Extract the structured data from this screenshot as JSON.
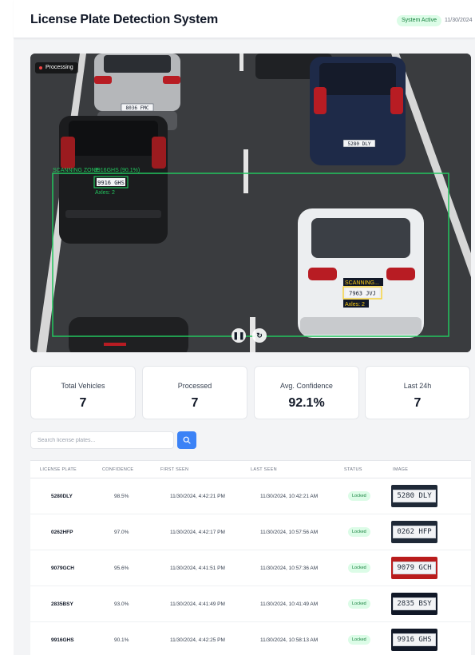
{
  "header": {
    "title": "License Plate Detection System",
    "status": "System Active",
    "date": "11/30/2024"
  },
  "feed": {
    "processing_label": "Processing",
    "zone_label": "SCANNING ZONE",
    "detection_1": {
      "label": "9916GHS (90.1%)",
      "plate": "9916 GHS",
      "axles": "Axles: 2"
    },
    "detection_2": {
      "label": "SCANNING...",
      "plate": "7963 JVJ",
      "axles": "Axles: 2"
    },
    "car_plates": [
      "8036 FMC",
      "5280 DLY"
    ],
    "pause_icon": "pause-icon",
    "refresh_icon": "refresh-icon"
  },
  "stats": [
    {
      "label": "Total Vehicles",
      "value": "7"
    },
    {
      "label": "Processed",
      "value": "7"
    },
    {
      "label": "Avg. Confidence",
      "value": "92.1%"
    },
    {
      "label": "Last 24h",
      "value": "7"
    }
  ],
  "search": {
    "placeholder": "Search license plates...",
    "icon": "search-icon"
  },
  "table": {
    "headers": [
      "LICENSE PLATE",
      "CONFIDENCE",
      "FIRST SEEN",
      "LAST SEEN",
      "STATUS",
      "IMAGE"
    ],
    "rows": [
      {
        "plate": "5280DLY",
        "confidence": "98.5%",
        "first_seen": "11/30/2024, 4:42:21 PM",
        "last_seen": "11/30/2024, 10:42:21 AM",
        "status": "Locked",
        "image_text": "5280 DLY"
      },
      {
        "plate": "0262HFP",
        "confidence": "97.0%",
        "first_seen": "11/30/2024, 4:42:17 PM",
        "last_seen": "11/30/2024, 10:57:56 AM",
        "status": "Locked",
        "image_text": "0262 HFP"
      },
      {
        "plate": "9079GCH",
        "confidence": "95.6%",
        "first_seen": "11/30/2024, 4:41:51 PM",
        "last_seen": "11/30/2024, 10:57:36 AM",
        "status": "Locked",
        "image_text": "9079 GCH"
      },
      {
        "plate": "2835BSY",
        "confidence": "93.0%",
        "first_seen": "11/30/2024, 4:41:49 PM",
        "last_seen": "11/30/2024, 10:41:49 AM",
        "status": "Locked",
        "image_text": "2835 BSY"
      },
      {
        "plate": "9916GHS",
        "confidence": "90.1%",
        "first_seen": "11/30/2024, 4:42:25 PM",
        "last_seen": "11/30/2024, 10:58:13 AM",
        "status": "Locked",
        "image_text": "9916 GHS"
      }
    ]
  },
  "colors": {
    "accent": "#3b82f6",
    "success_bg": "#dcfce7",
    "success_text": "#15803d",
    "zone_green": "#22c55e",
    "scanning_yellow": "#facc15"
  }
}
